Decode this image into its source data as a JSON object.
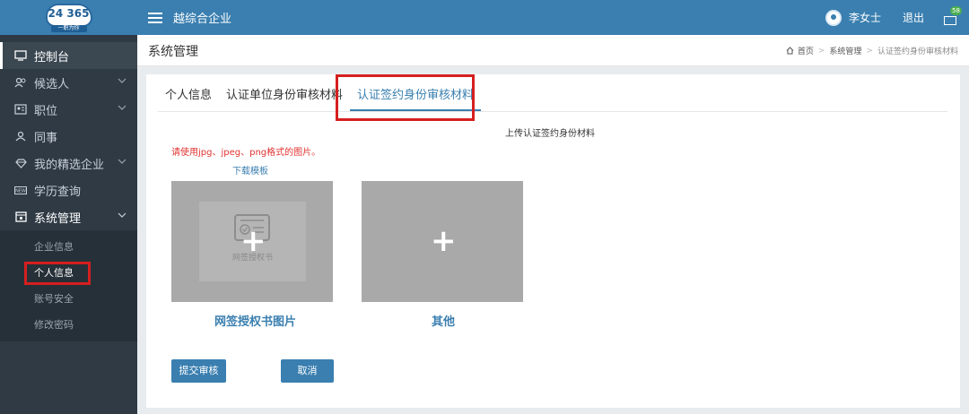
{
  "logo": {
    "number": "24 365",
    "tagline": "一职为你"
  },
  "topbar": {
    "company": "越综合企业",
    "username": "李女士",
    "logout": "退出",
    "mail_count": "58"
  },
  "sidebar": {
    "items": [
      {
        "label": "控制台",
        "icon": "monitor-icon"
      },
      {
        "label": "候选人",
        "icon": "users-icon"
      },
      {
        "label": "职位",
        "icon": "id-card-icon"
      },
      {
        "label": "同事",
        "icon": "person-icon"
      },
      {
        "label": "我的精选企业",
        "icon": "diamond-icon"
      },
      {
        "label": "学历查询",
        "icon": "new-badge-icon"
      },
      {
        "label": "系统管理",
        "icon": "settings-box-icon"
      }
    ],
    "submenu": [
      "企业信息",
      "个人信息",
      "账号安全",
      "修改密码"
    ]
  },
  "page": {
    "title": "系统管理",
    "breadcrumb": [
      "首页",
      "系统管理",
      "认证签约身份审核材料"
    ]
  },
  "tabs": [
    "个人信息",
    "认证单位身份审核材料",
    "认证签约身份审核材料"
  ],
  "content": {
    "upload_title": "上传认证签约身份材料",
    "hint": "请使用jpg、jpeg、png格式的图片。",
    "download": "下载模板",
    "cert_label": "网签授权书",
    "upload1_caption": "网签授权书图片",
    "upload2_caption": "其他",
    "submit": "提交审核",
    "cancel": "取消"
  },
  "colors": {
    "primary": "#3a7fb0",
    "sidebar": "#2f3a44",
    "highlight": "#d51f1f",
    "hint": "#e0332f"
  }
}
